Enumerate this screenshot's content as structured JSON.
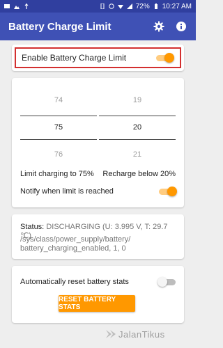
{
  "statusbar": {
    "battery": "72%",
    "time": "10:27 AM"
  },
  "appbar": {
    "title": "Battery Charge Limit",
    "settings_icon": "gear-icon",
    "info_icon": "info-icon"
  },
  "enable": {
    "label": "Enable Battery Charge Limit",
    "on": true
  },
  "picker_limit": {
    "prev": "74",
    "current": "75",
    "next": "76"
  },
  "picker_recharge": {
    "prev": "19",
    "current": "20",
    "next": "21"
  },
  "limits": {
    "limit_text": "Limit charging to 75%",
    "recharge_text": "Recharge below 20%"
  },
  "notify": {
    "label": "Notify when limit is reached",
    "on": true
  },
  "status": {
    "label": "Status:",
    "value": "DISCHARGING (U: 3.995 V, T: 29.7 ℃)",
    "path": "/sys/class/power_supply/battery/ battery_charging_enabled, 1, 0"
  },
  "reset": {
    "label": "Automatically reset battery stats",
    "on": false,
    "button": "RESET BATTERY STATS"
  },
  "watermark": "JalanTikus",
  "colors": {
    "primary": "#3f51b5",
    "primary_dark": "#303f9f",
    "accent": "#ff9800",
    "highlight": "#d32f2f"
  }
}
